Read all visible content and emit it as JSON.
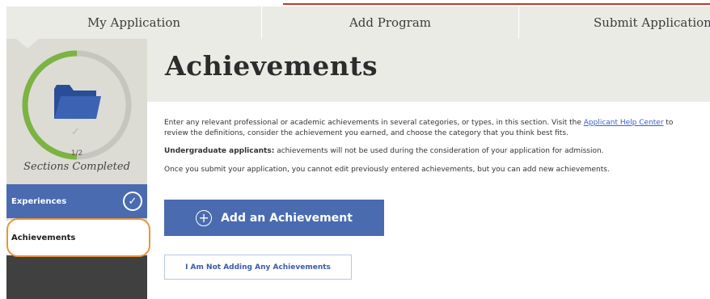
{
  "topnav": {
    "tabs": [
      "My Application",
      "Add Program",
      "Submit Application"
    ]
  },
  "sidebar": {
    "progress": {
      "completed": 1,
      "total": 2,
      "fraction_label": "1/2",
      "label": "Sections Completed"
    },
    "icons": {
      "section_icon": "folder-icon",
      "status_icon": "check-icon"
    },
    "items": [
      {
        "label": "Experiences",
        "status": "complete",
        "icon": "check-circle-icon"
      },
      {
        "label": "Achievements",
        "status": "current"
      }
    ]
  },
  "page": {
    "title": "Achievements",
    "intro_before_link": "Enter any relevant professional or academic achievements in several categories, or types, in this section. Visit the ",
    "help_link": "Applicant Help Center",
    "intro_after_link": " to review the definitions, consider the achievement you earned, and choose the category that you think best fits.",
    "undergrad_label": "Undergraduate applicants:",
    "undergrad_text": " achievements will not be used during the consideration of your application for admission.",
    "submit_note": "Once you submit your application, you cannot edit previously entered achievements, but you can add new achievements."
  },
  "buttons": {
    "add_label": "Add an Achievement",
    "add_icon": "plus-circle-icon",
    "none_label": "I Am Not Adding Any Achievements"
  },
  "colors": {
    "accent_blue": "#4a6bb0",
    "progress_green": "#7cb342",
    "highlight_orange": "#e8953a"
  }
}
